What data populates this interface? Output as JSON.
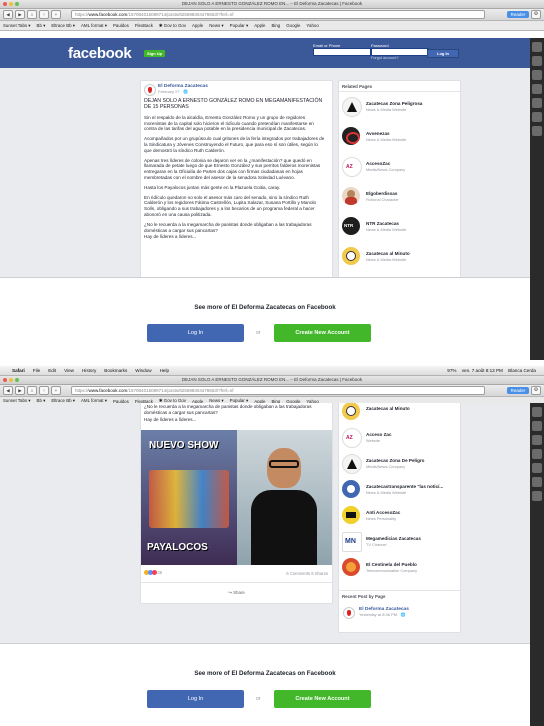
{
  "browser": {
    "window_title": "DEJAN SOLO A ERNESTO GONZÁLEZ ROMO EN... – El Deforma Zacatecas | Facebook",
    "url_prefix": "https://",
    "url_domain": "www.facebook.com",
    "url_path": "/157084015089714/posts/825598304478653/?fref=nf",
    "reader_label": "Reader",
    "gear_icon": "gear-icon",
    "bookmarks": [
      "Sunset Tabs ▾",
      "Bb ▾",
      "Eltrace Bb ▾",
      "AML format ▾",
      "Pauldos",
      "FlexBack",
      "✱ Gov to Gov",
      "Apple",
      "News ▾",
      "Popular ▾",
      "Apple",
      "Bing",
      "Google",
      "Yahoo"
    ],
    "menu": [
      "Safari",
      "File",
      "Edit",
      "View",
      "History",
      "Bookmarks",
      "Window",
      "Help"
    ],
    "menu_status": [
      "97%",
      "ven. 7 août 8:13 PM",
      "Blanca Cerda"
    ]
  },
  "facebook": {
    "logo": "facebook",
    "signup_label": "Sign Up",
    "email_label": "Email or Phone",
    "password_label": "Password",
    "forgot_label": "Forgot account?",
    "login_label": "Log In"
  },
  "post": {
    "page_name": "El Deforma Zacatecas",
    "time": "February 27 · 🌐",
    "headline": "DEJAN SOLO A ERNESTO GONZÁLEZ ROMO EN MEGAMANIFESTACIÓN DE 15 PERSONAS",
    "paragraphs": [
      "Sin el respaldo de la alcaldía, Ernesto González Romo y un grupo de regidores morenistas de la capital solo hicieron el ridículo cuando pretendían manifestarse en contra de las tarifas del agua potable en la presidencia municipal de Zacatecas.",
      "Acompañados por un grupúsculo cual gritones de la fería integrados por trabajadores de la Sindicatura y Jóvenes Construyendo el Futuro, que para eso sí son útiles, según lo que demostró la síndico Ruth Calderón.",
      "Apenas tres líderes de colonia se dejaron ver en la ¿manifestación? que quedó en llamarada de petate luego de que Ernesto González y sus perritos falderos morenistas entregaran en la Oficialía de Partes dos cajas con firmas ciudadanas en hojas membretadas con el nombre del asesor de la senadora Soledad Luévano.",
      "Hasta los Payalocos juntan más gente en la Plazuela Goitia, caray.",
      "En ridículo quedaron no solo el asesor más caro del senado, sino la síndico Ruth Calderón y los regidores Fátima Castrellón, Lupita Salazar, Susana Portillo y Manolo Solís, obligando a sus trabajadores y a los becarios de un programa federal a hacer abonoró en una causa politizada.",
      "¿No le recuerda a la megamarcha de panistas donde obligaban a las trabajadoras domésticas a cargar sus pancartas?",
      "Hay de líderes a líderes..."
    ],
    "continued_paragraphs": [
      "¿No le recuerda a la megamarcha de panistas donde obligaban a las trabajadoras domésticas a cargar sus pancartas?",
      "Hay de líderes a líderes..."
    ],
    "photo_title": "NUEVO SHOW",
    "photo_caption": "PAYALOCOS",
    "reaction_count": "36",
    "comments_shares": "6 Comments  6 Shares",
    "share_label": "Share"
  },
  "related": {
    "title": "Related Pages",
    "items": [
      {
        "name": "Zacatecas Zona Peligrosa",
        "sub": "News & Media Website",
        "color": "#f4f4f4"
      },
      {
        "name": "Avvenezas",
        "sub": "News & Media Website",
        "color": "#222222"
      },
      {
        "name": "AccesoZac",
        "sub": "Media/News Company",
        "color": "#ffffff"
      },
      {
        "name": "Elgoberdissas",
        "sub": "Fictional Character",
        "color": "#e9d8c7"
      },
      {
        "name": "NTR Zacatecas",
        "sub": "News & Media Website",
        "color": "#1e1e1e"
      },
      {
        "name": "Zacatecas al Minuto",
        "sub": "News & Media Website",
        "color": "#f2c94c"
      }
    ],
    "items2": [
      {
        "name": "Zacatecas al Minuto",
        "sub": "",
        "color": "#f2c94c"
      },
      {
        "name": "Acceso Zac",
        "sub": "Website",
        "color": "#ffffff"
      },
      {
        "name": "Zacatecas Zona De Peligro",
        "sub": "Media/News Company",
        "color": "#f4f4f4"
      },
      {
        "name": "Zacatecastransparente \"las noticí...",
        "sub": "News & Media Website",
        "color": "#4267b2"
      },
      {
        "name": "Anti AccesoZac",
        "sub": "News Personality",
        "color": "#f1d02b"
      },
      {
        "name": "Megamedicias Zacatecas",
        "sub": "TV Channel",
        "color": "#ffffff"
      },
      {
        "name": "El Centinela del Pueblo",
        "sub": "Telecommunication Company",
        "color": "#d94b2b"
      }
    ],
    "recent_title": "Recent Post by Page",
    "recent_name": "El Deforma Zacatecas",
    "recent_time": "Yesterday at 8:36 PM · 🌐"
  },
  "cta": {
    "see_more": "See more of El Deforma Zacatecas on Facebook",
    "login": "Log In",
    "or": "or",
    "create": "Create New Account"
  }
}
